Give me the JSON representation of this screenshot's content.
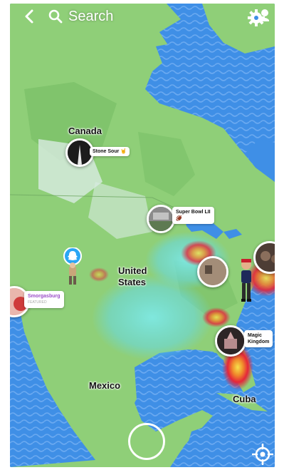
{
  "header": {
    "search_placeholder": "Search",
    "back_icon": "chevron-left-icon",
    "settings_icon": "gear-icon"
  },
  "map": {
    "labels": {
      "canada": "Canada",
      "united_states_line1": "United",
      "united_states_line2": "States",
      "mexico": "Mexico",
      "cuba": "Cuba"
    },
    "colors": {
      "ocean": "#3f8fe6",
      "land": "#8fcf78",
      "heat_cyan": "#5ce0e0",
      "heat_red": "#e5253a",
      "heat_yellow": "#f6e24b"
    }
  },
  "stories": {
    "stone_sour": {
      "label": "Stone Sour 🤘"
    },
    "super_bowl": {
      "label": "Super Bowl LII",
      "emoji": "🏈"
    },
    "smorgasburg": {
      "label": "Smorgasburg",
      "tag": "FEATURED"
    },
    "magic_kingdom": {
      "label_line1": "Magic",
      "label_line2": "Kingdom"
    }
  },
  "footer": {
    "shutter_icon": "camera-shutter-icon",
    "locate_icon": "locate-icon"
  }
}
